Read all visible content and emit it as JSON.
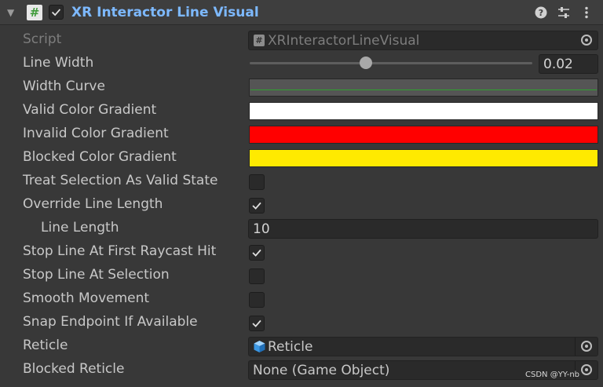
{
  "component": {
    "title": "XR Interactor Line Visual",
    "enabled": true,
    "icons": [
      "foldout-arrow-icon",
      "script-icon",
      "help-icon",
      "preset-icon",
      "kebab-menu-icon"
    ]
  },
  "fields": {
    "script": {
      "label": "Script",
      "value": "XRInteractorLineVisual"
    },
    "line_width": {
      "label": "Line Width",
      "value": "0.02",
      "slider_fraction": 0.41
    },
    "width_curve": {
      "label": "Width Curve",
      "curve_color": "#2fa12f"
    },
    "valid_color_gradient": {
      "label": "Valid Color Gradient",
      "color": "#ffffff"
    },
    "invalid_color_gradient": {
      "label": "Invalid Color Gradient",
      "color": "#ff0000"
    },
    "blocked_color_gradient": {
      "label": "Blocked Color Gradient",
      "color": "#ffea00"
    },
    "treat_selection_as_valid_state": {
      "label": "Treat Selection As Valid State",
      "checked": false
    },
    "override_line_length": {
      "label": "Override Line Length",
      "checked": true
    },
    "line_length": {
      "label": "Line Length",
      "value": "10"
    },
    "stop_line_at_first_raycast_hit": {
      "label": "Stop Line At First Raycast Hit",
      "checked": true
    },
    "stop_line_at_selection": {
      "label": "Stop Line At Selection",
      "checked": false
    },
    "smooth_movement": {
      "label": "Smooth Movement",
      "checked": false
    },
    "snap_endpoint_if_available": {
      "label": "Snap Endpoint If Available",
      "checked": true
    },
    "reticle": {
      "label": "Reticle",
      "value": "Reticle"
    },
    "blocked_reticle": {
      "label": "Blocked Reticle",
      "value": "None (Game Object)"
    }
  },
  "watermark": "CSDN @YY-nb",
  "colors": {
    "accent_title": "#7db9ff",
    "panel_bg": "#383838",
    "field_bg": "#2a2a2a"
  }
}
